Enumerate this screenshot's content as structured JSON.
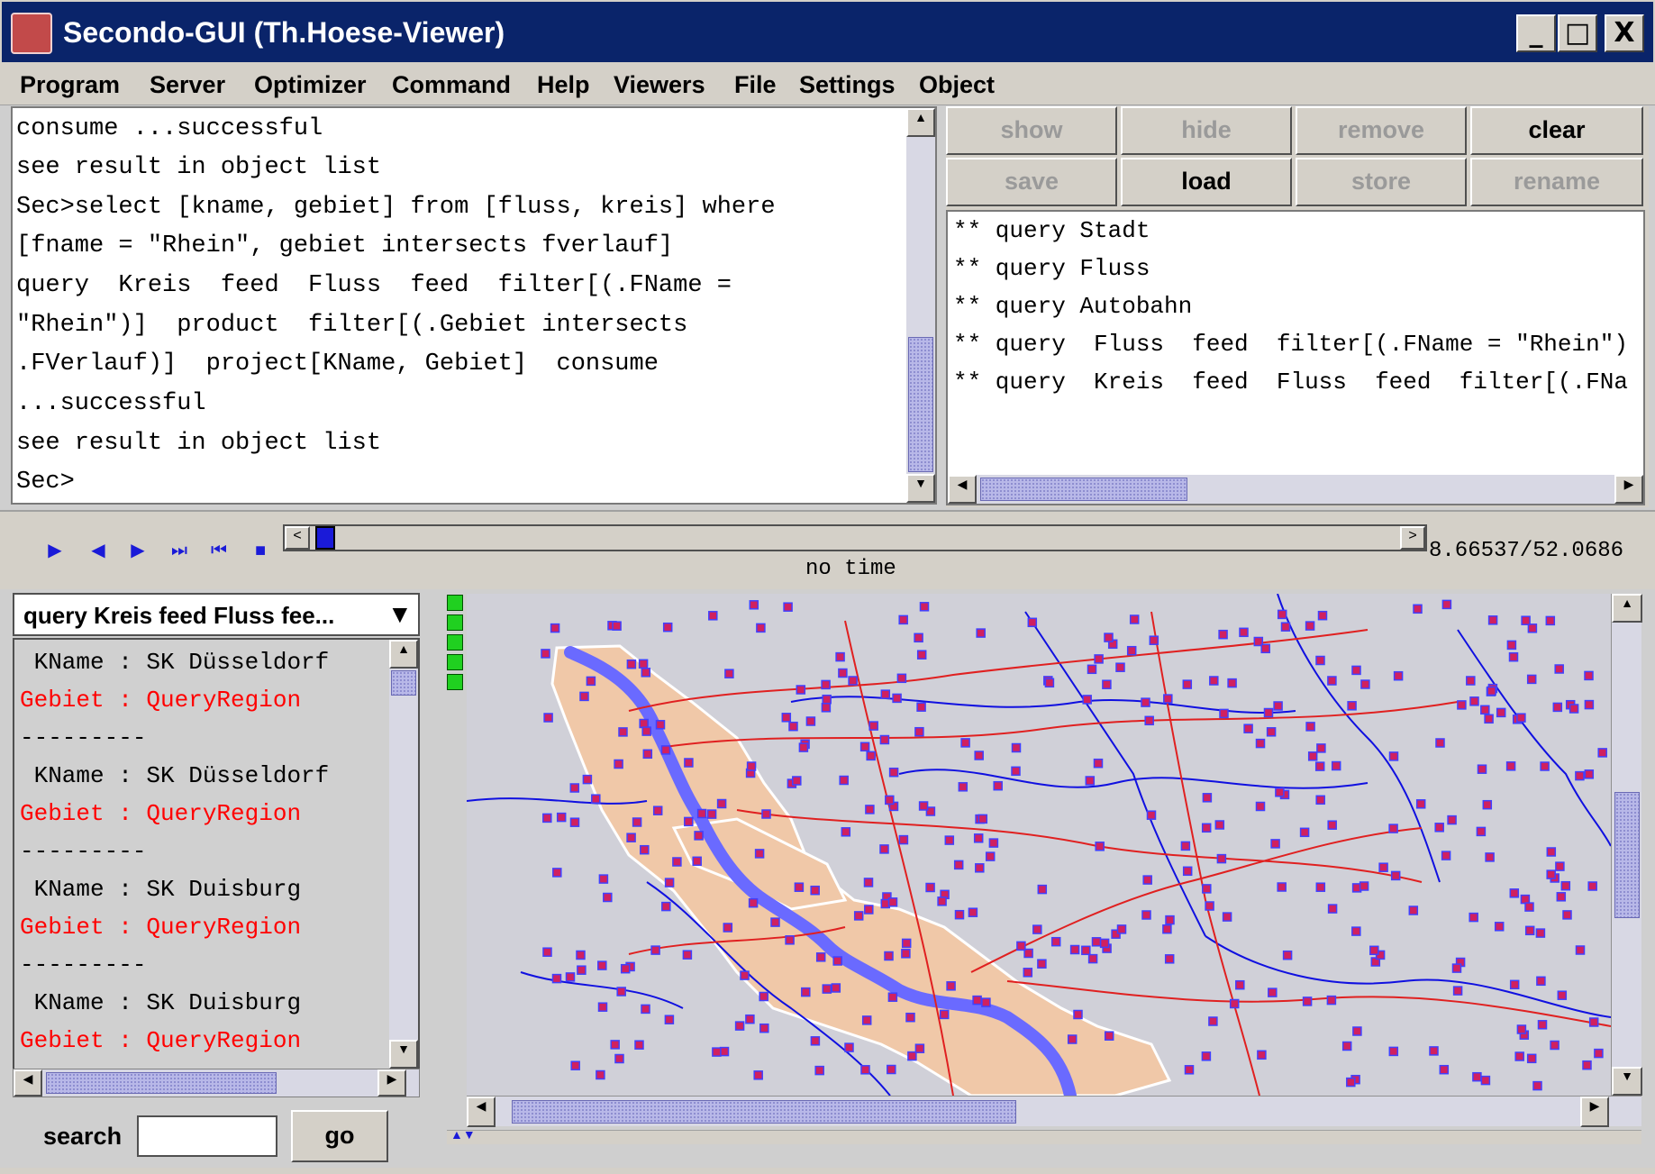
{
  "window": {
    "title": "Secondo-GUI (Th.Hoese-Viewer)",
    "controls": {
      "minimize": "_",
      "maximize": "□",
      "close": "X"
    }
  },
  "menu": [
    "Program",
    "Server",
    "Optimizer",
    "Command",
    "Help",
    "Viewers",
    "File",
    "Settings",
    "Object"
  ],
  "console": {
    "lines": [
      "consume ...successful",
      "see result in object list",
      "Sec>select [kname, gebiet] from [fluss, kreis] where",
      "[fname = \"Rhein\", gebiet intersects fverlauf]",
      "query  Kreis  feed  Fluss  feed  filter[(.FName =",
      "\"Rhein\")]  product  filter[(.Gebiet intersects",
      ".FVerlauf)]  project[KName, Gebiet]  consume",
      "...successful",
      "see result in object list",
      "Sec>"
    ]
  },
  "object_list": {
    "buttons": [
      {
        "label": "show",
        "enabled": false
      },
      {
        "label": "hide",
        "enabled": false
      },
      {
        "label": "remove",
        "enabled": false
      },
      {
        "label": "clear",
        "enabled": true
      },
      {
        "label": "save",
        "enabled": false
      },
      {
        "label": "load",
        "enabled": true
      },
      {
        "label": "store",
        "enabled": false
      },
      {
        "label": "rename",
        "enabled": false
      }
    ],
    "items": [
      "** query Stadt",
      "** query Fluss",
      "** query Autobahn",
      "** query  Fluss  feed  filter[(.FName = \"Rhein\")",
      "** query  Kreis  feed  Fluss  feed  filter[(.FNa"
    ]
  },
  "timeline": {
    "label": "no time",
    "coordinates": "8.66537/52.0686",
    "start_btn": "<",
    "end_btn": ">"
  },
  "results": {
    "selected_query": "query Kreis feed Fluss fee...",
    "lines": [
      {
        "text": " KName : SK Düsseldorf",
        "color": "#000000"
      },
      {
        "text": "Gebiet : QueryRegion",
        "color": "#ff0000"
      },
      {
        "text": "---------",
        "color": "#000000"
      },
      {
        "text": " KName : SK Düsseldorf",
        "color": "#000000"
      },
      {
        "text": "Gebiet : QueryRegion",
        "color": "#ff0000"
      },
      {
        "text": "---------",
        "color": "#000000"
      },
      {
        "text": " KName : SK Duisburg",
        "color": "#000000"
      },
      {
        "text": "Gebiet : QueryRegion",
        "color": "#ff0000"
      },
      {
        "text": "---------",
        "color": "#000000"
      },
      {
        "text": " KName : SK Duisburg",
        "color": "#000000"
      },
      {
        "text": "Gebiet : QueryRegion",
        "color": "#ff0000"
      }
    ],
    "search_label": "search",
    "search_value": "",
    "go_label": "go"
  },
  "colors": {
    "title_bg": "#0a246a",
    "region_fill": "#f0c8a8",
    "river_main": "#6a6aff",
    "rivers": "#1010e0",
    "roads": "#e02020",
    "cities": "#d02060",
    "map_bg": "#d0d0d8"
  }
}
